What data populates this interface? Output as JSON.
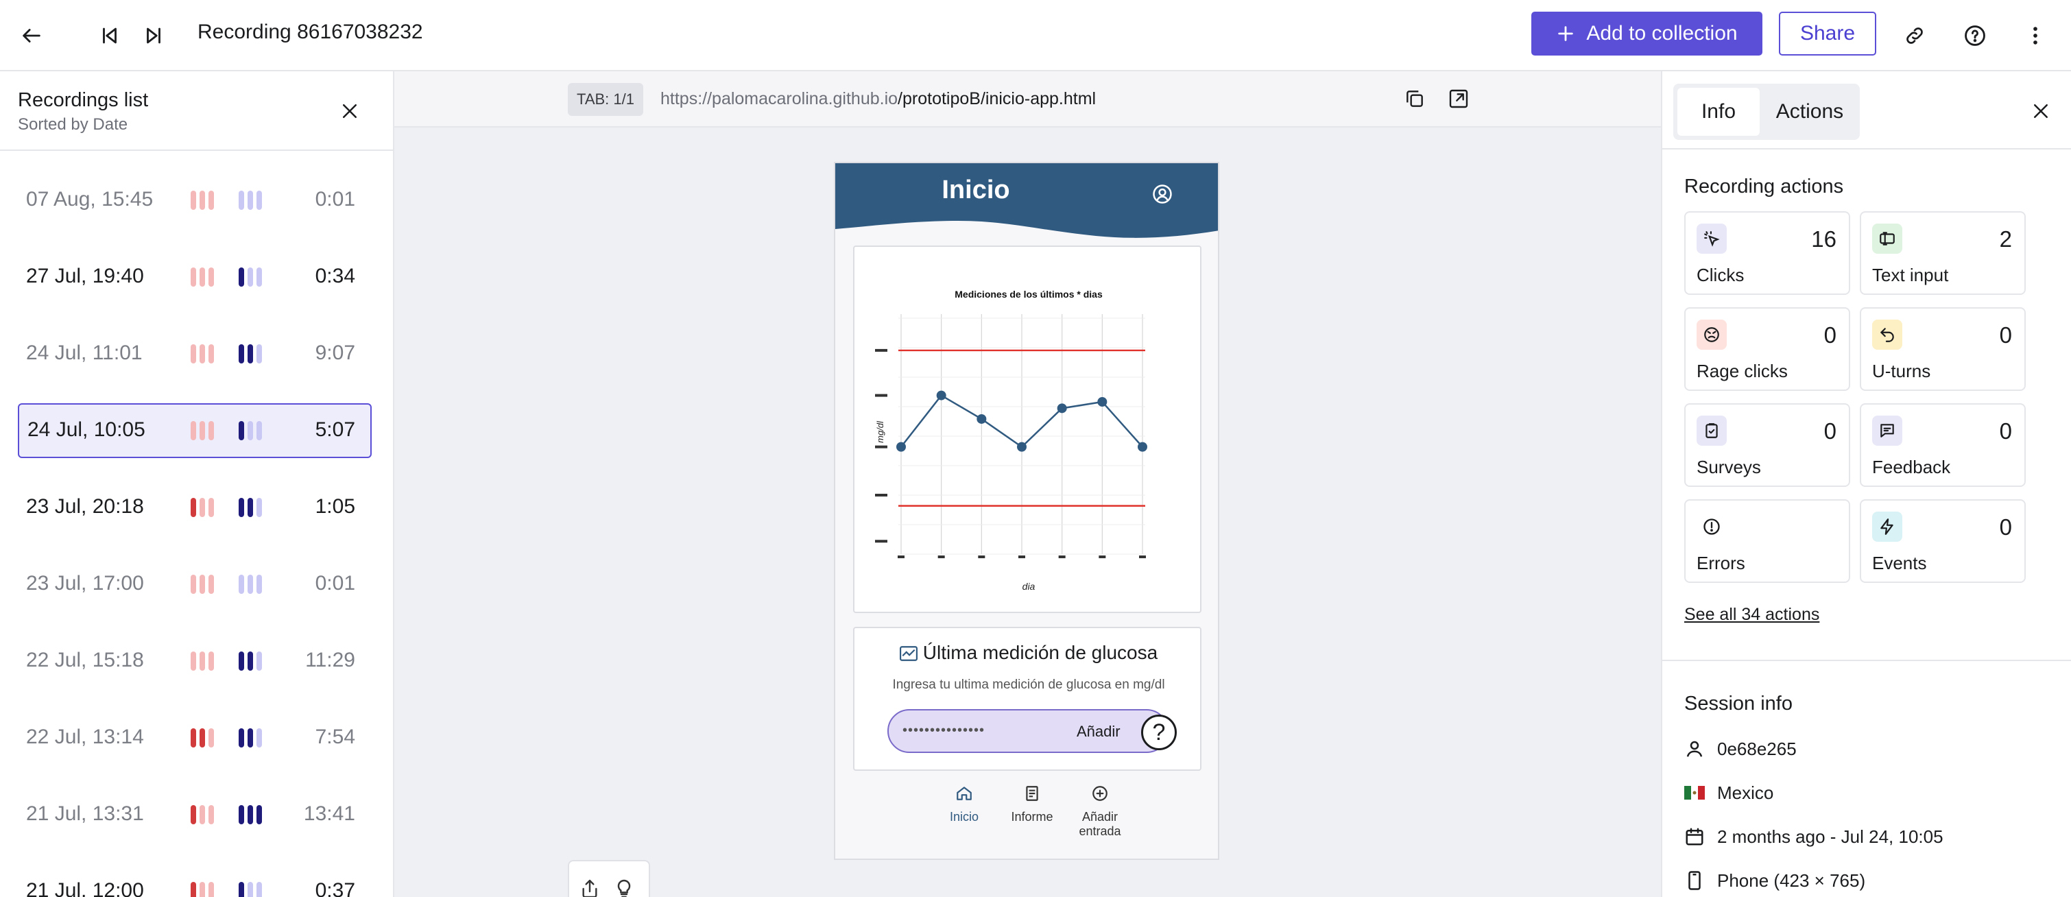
{
  "header": {
    "title": "Recording 86167038232",
    "add_to_collection": "Add to collection",
    "share": "Share"
  },
  "recordings_list": {
    "title": "Recordings list",
    "subtitle": "Sorted by Date",
    "items": [
      {
        "date": "07 Aug, 15:45",
        "duration": "0:01",
        "visited": true
      },
      {
        "date": "27 Jul, 19:40",
        "duration": "0:34",
        "visited": false
      },
      {
        "date": "24 Jul, 11:01",
        "duration": "9:07",
        "visited": true
      },
      {
        "date": "24 Jul, 10:05",
        "duration": "5:07",
        "visited": false,
        "selected": true
      },
      {
        "date": "23 Jul, 20:18",
        "duration": "1:05",
        "visited": false
      },
      {
        "date": "23 Jul, 17:00",
        "duration": "0:01",
        "visited": true
      },
      {
        "date": "22 Jul, 15:18",
        "duration": "11:29",
        "visited": true
      },
      {
        "date": "22 Jul, 13:14",
        "duration": "7:54",
        "visited": true
      },
      {
        "date": "21 Jul, 13:31",
        "duration": "13:41",
        "visited": true
      },
      {
        "date": "21 Jul, 12:00",
        "duration": "0:37",
        "visited": true
      }
    ]
  },
  "browser": {
    "tab_label": "TAB: 1/1",
    "url_base": "https://palomacarolina.github.io",
    "url_path": "/prototipoB/inicio-app.html"
  },
  "app": {
    "title": "Inicio",
    "chart_title": "Mediciones de los últimos * dias",
    "chart_xlabel": "dia",
    "chart_ylabel": "mg/dl",
    "glucose_title": "Última medición de glucosa",
    "glucose_subtitle": "Ingresa tu ultima medición de glucosa en mg/dl",
    "glucose_input_value": "•••••••••••••••",
    "glucose_add": "Añadir",
    "help": "?",
    "nav": [
      {
        "label": "Inicio",
        "active": true
      },
      {
        "label": "Informe",
        "active": false
      },
      {
        "label": "Añadir entrada",
        "active": false
      }
    ]
  },
  "chart_data": {
    "type": "line",
    "title": "Mediciones de los últimos * dias",
    "xlabel": "dia",
    "ylabel": "mg/dl",
    "x": [
      1,
      2,
      3,
      4,
      5,
      6,
      7
    ],
    "series": [
      {
        "values": [
          100,
          148,
          126,
          100,
          136,
          142,
          100
        ]
      }
    ],
    "reference_lines": [
      190,
      45
    ],
    "ylim": [
      0,
      220
    ],
    "grid": true
  },
  "info_panel": {
    "tabs": [
      "Info",
      "Actions"
    ],
    "recording_actions_title": "Recording actions",
    "stats": [
      {
        "label": "Clicks",
        "value": "16",
        "icon": "cursor-click-icon",
        "color": "#e8e7f8"
      },
      {
        "label": "Text input",
        "value": "2",
        "icon": "text-input-icon",
        "color": "#dff3e1"
      },
      {
        "label": "Rage clicks",
        "value": "0",
        "icon": "angry-face-icon",
        "color": "#fde2dd"
      },
      {
        "label": "U-turns",
        "value": "0",
        "icon": "u-turn-icon",
        "color": "#fdf0c4"
      },
      {
        "label": "Surveys",
        "value": "0",
        "icon": "clipboard-icon",
        "color": "#e8e7f8"
      },
      {
        "label": "Feedback",
        "value": "0",
        "icon": "feedback-icon",
        "color": "#e8e7f8"
      },
      {
        "label": "Errors",
        "value": "",
        "icon": "error-icon",
        "color": "#ffffff"
      },
      {
        "label": "Events",
        "value": "0",
        "icon": "bolt-icon",
        "color": "#d9f2f5"
      }
    ],
    "see_all": "See all 34 actions",
    "session_info_title": "Session info",
    "session": {
      "user_id": "0e68e265",
      "country": "Mexico",
      "date": "2 months ago - Jul 24, 10:05",
      "device": "Phone (423 × 765)"
    }
  }
}
